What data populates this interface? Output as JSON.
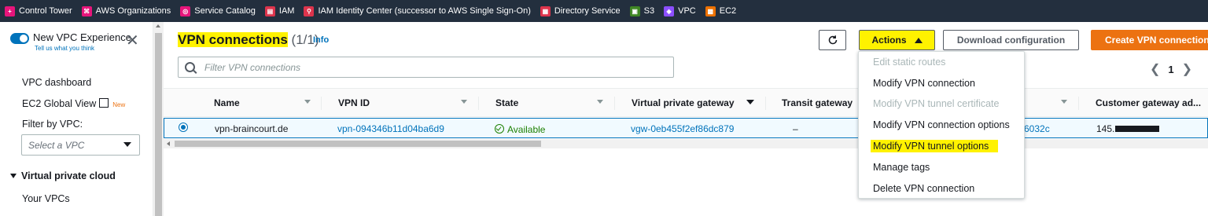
{
  "favorites": [
    {
      "label": "Control Tower",
      "icon": "control-tower-icon",
      "color": "#e7157b"
    },
    {
      "label": "AWS Organizations",
      "icon": "organizations-icon",
      "color": "#e7157b"
    },
    {
      "label": "Service Catalog",
      "icon": "service-catalog-icon",
      "color": "#e7157b"
    },
    {
      "label": "IAM",
      "icon": "iam-icon",
      "color": "#dd344c"
    },
    {
      "label": "IAM Identity Center (successor to AWS Single Sign-On)",
      "icon": "identity-center-icon",
      "color": "#dd344c"
    },
    {
      "label": "Directory Service",
      "icon": "directory-service-icon",
      "color": "#dd344c"
    },
    {
      "label": "S3",
      "icon": "s3-icon",
      "color": "#3f8624"
    },
    {
      "label": "VPC",
      "icon": "vpc-icon",
      "color": "#8c4fff"
    },
    {
      "label": "EC2",
      "icon": "ec2-icon",
      "color": "#ed7100"
    }
  ],
  "sidebar": {
    "new_vpc_experience": "New VPC Experience",
    "tell_us": "Tell us what you think",
    "vpc_dashboard": "VPC dashboard",
    "ec2_global_view": "EC2 Global View",
    "new_badge": "New",
    "filter_label": "Filter by VPC:",
    "select_placeholder": "Select a VPC",
    "section_title": "Virtual private cloud",
    "your_vpcs": "Your VPCs"
  },
  "header": {
    "title_highlight": "VPN connections",
    "title_count": " (1/1)",
    "info": "Info",
    "search_placeholder": "Filter VPN connections",
    "actions": "Actions",
    "download": "Download configuration",
    "create": "Create VPN connection",
    "page": "1",
    "prev": "❮",
    "next": "❯"
  },
  "table": {
    "columns": [
      "Name",
      "VPN ID",
      "State",
      "Virtual private gateway",
      "Transit gateway",
      "Customer gateway ad..."
    ],
    "row": {
      "name": "vpn-braincourt.de",
      "vpn_id": "vpn-094346b11d04ba6d9",
      "state": "Available",
      "vgw": "vgw-0eb455f2ef86dc879",
      "transit": "–",
      "cgw_partial": "6032c",
      "customer_addr_prefix": "145."
    }
  },
  "menu": {
    "items": [
      {
        "label": "Edit static routes",
        "disabled": true
      },
      {
        "label": "Modify VPN connection",
        "disabled": false
      },
      {
        "label": "Modify VPN tunnel certificate",
        "disabled": true
      },
      {
        "label": "Modify VPN connection options",
        "disabled": false
      },
      {
        "label": "Modify VPN tunnel options",
        "disabled": false,
        "highlighted": true
      },
      {
        "label": "Manage tags",
        "disabled": false
      },
      {
        "label": "Delete VPN connection",
        "disabled": false
      }
    ]
  },
  "colors": {
    "topbar": "#232f3e",
    "link": "#0073bb",
    "primary": "#ec7211",
    "highlight": "#fff200",
    "success": "#1d8102"
  }
}
